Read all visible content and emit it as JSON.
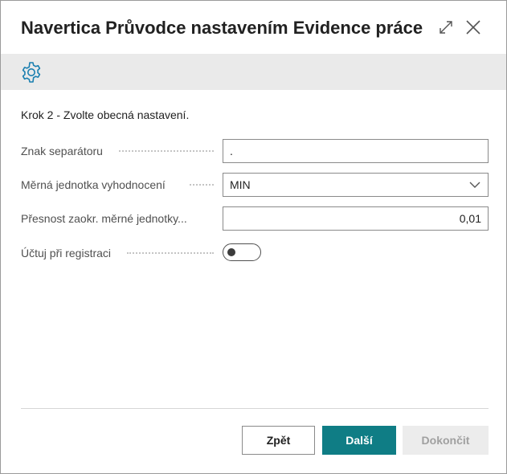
{
  "dialog": {
    "title": "Navertica Průvodce nastavením Evidence práce ...",
    "expand_icon": "expand-diagonal-icon",
    "close_icon": "close-icon"
  },
  "actionbar": {
    "settings_icon": "gear-icon"
  },
  "step_text": "Krok 2 - Zvolte obecná nastavení.",
  "fields": [
    {
      "label": "Znak separátoru",
      "value": ".",
      "type": "text"
    },
    {
      "label": "Měrná jednotka vyhodnocení",
      "value": "MIN",
      "type": "select"
    },
    {
      "label": "Přesnost zaokr. měrné jednotky...",
      "value": "0,01",
      "type": "number"
    },
    {
      "label": "Účtuj při registraci",
      "value": false,
      "type": "toggle"
    }
  ],
  "buttons": {
    "back": "Zpět",
    "next": "Další",
    "finish": "Dokončit"
  },
  "colors": {
    "accent": "#0f7d85",
    "gear": "#1a7fb0",
    "actionbar_bg": "#eaeaea",
    "disabled_bg": "#ececec"
  }
}
